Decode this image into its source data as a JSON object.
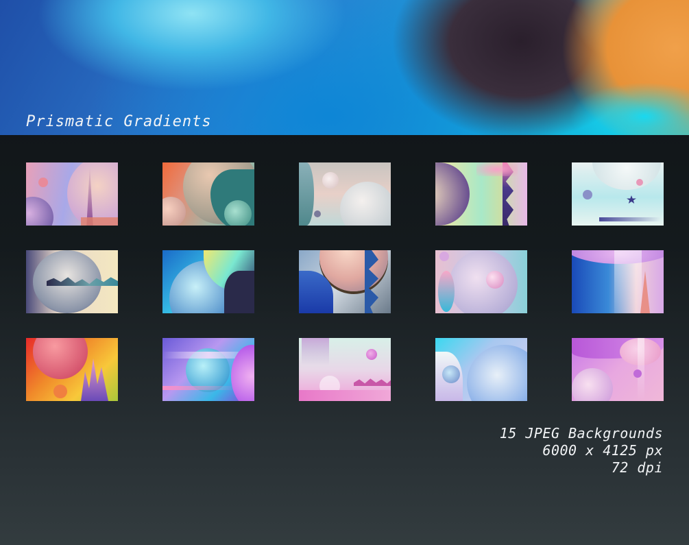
{
  "header": {
    "title": "Prismatic Gradients"
  },
  "info": {
    "line1": "15 JPEG Backgrounds",
    "line2": "6000 x 4125 px",
    "line3": "72 dpi"
  },
  "palette": {
    "background_top": "#0e1215",
    "background_bottom": "#333c3f",
    "text": "#f2f4f6"
  },
  "thumbnails": [
    {
      "name": "thumb-1"
    },
    {
      "name": "thumb-2"
    },
    {
      "name": "thumb-3"
    },
    {
      "name": "thumb-4"
    },
    {
      "name": "thumb-5"
    },
    {
      "name": "thumb-6"
    },
    {
      "name": "thumb-7"
    },
    {
      "name": "thumb-8"
    },
    {
      "name": "thumb-9"
    },
    {
      "name": "thumb-10"
    },
    {
      "name": "thumb-11"
    },
    {
      "name": "thumb-12"
    },
    {
      "name": "thumb-13"
    },
    {
      "name": "thumb-14"
    },
    {
      "name": "thumb-15"
    }
  ]
}
